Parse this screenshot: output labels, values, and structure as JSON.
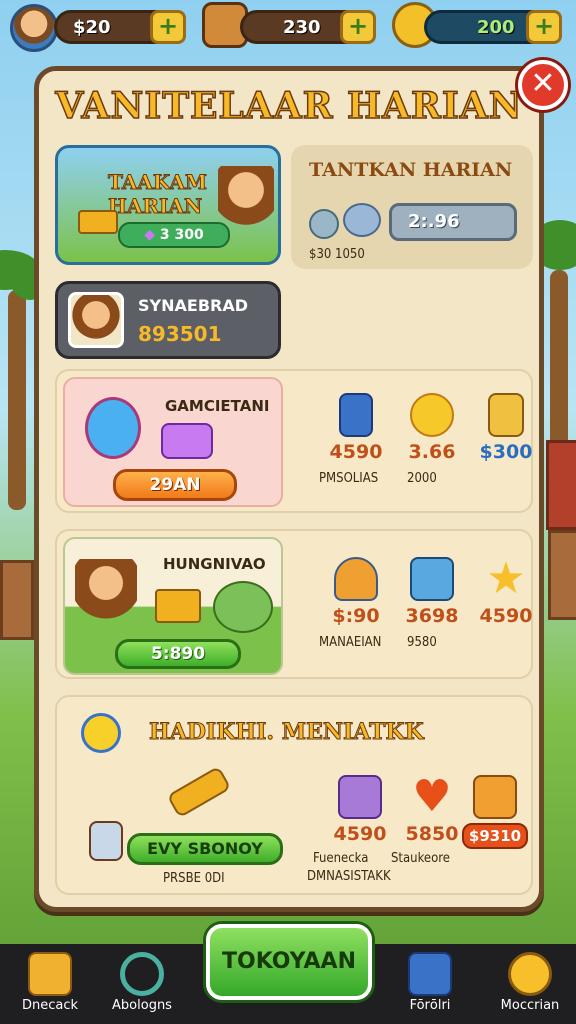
{
  "topbar": {
    "resources": [
      {
        "icon": "cash-icon",
        "value": "$20"
      },
      {
        "icon": "crate-icon",
        "value": "230"
      },
      {
        "icon": "smiley-coin-icon",
        "value": "200"
      }
    ]
  },
  "panel": {
    "title": "VANITELAAR HARIAN",
    "card1": {
      "title_line1": "TAAKAM",
      "title_line2": "HARIAN",
      "badge": "3 300"
    },
    "card2": {
      "title": "TANTKAN HARIAN",
      "field_value": "2:.96",
      "caption": "$30 1050"
    },
    "card3": {
      "title": "SYNAEBRAD",
      "value": "893501"
    },
    "card4": {
      "title": "GAMCIETANI",
      "button": "29AN",
      "rewards": [
        {
          "icon": "card-icon",
          "value": "4590",
          "color": "#c0501a"
        },
        {
          "icon": "sun-icon",
          "value": "3.66",
          "color": "#c0501a"
        },
        {
          "icon": "house-icon",
          "value": "$300",
          "color": "#2a6fbf"
        }
      ],
      "caption1": "PMSOLIAS",
      "caption2": "2000"
    },
    "card5": {
      "title": "HUNGNIVAO",
      "button": "5:890",
      "rewards": [
        {
          "icon": "shell-icon",
          "value": "$:90",
          "color": "#c0501a"
        },
        {
          "icon": "gem-icon",
          "value": "3698",
          "color": "#c0501a"
        },
        {
          "icon": "star-icon",
          "value": "4590",
          "color": "#c0501a"
        }
      ],
      "caption1": "MANAEIAN",
      "caption2": "9580"
    },
    "card6": {
      "title": "HADIKHI. MENIATKK",
      "button": "EVY SBONOY",
      "caption": "PRSBE 0DI",
      "rewards": [
        {
          "icon": "puzzle-icon",
          "value": "4590",
          "color": "#c0501a"
        },
        {
          "icon": "heart-icon",
          "value": "5850",
          "color": "#c0501a"
        },
        {
          "icon": "treasure-icon",
          "value": "$9310",
          "color": "#fff"
        }
      ],
      "caption1": "Fuenecka",
      "caption2": "DMNASISTAKK",
      "caption3": "Staukeore"
    }
  },
  "bottomnav": {
    "items": [
      {
        "icon": "home-icon",
        "label": "Dnecack"
      },
      {
        "icon": "magnifier-icon",
        "label": "Abologns"
      },
      {
        "icon": "shield-icon",
        "label": "Fōrōlri"
      },
      {
        "icon": "gear-icon",
        "label": "Moccrian"
      }
    ],
    "center_button": "TOKOYAAN"
  },
  "colors": {
    "panel_bg": "#f3e6c6",
    "panel_border": "#6b4a2a",
    "accent_gold": "#f7b928",
    "close_red": "#e23a2a"
  }
}
